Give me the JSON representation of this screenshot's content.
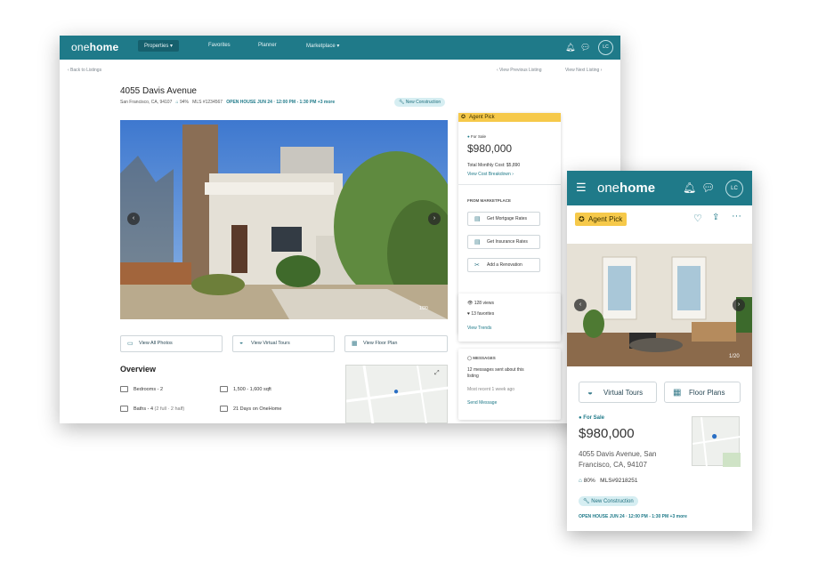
{
  "desktop": {
    "nav": {
      "logo_pre": "one",
      "logo_post": "home",
      "menu": [
        "Properties ▾",
        "Favorites",
        "Planner",
        "Marketplace ▾"
      ],
      "avatar": "LC"
    },
    "back_link": "‹ Back to Listings",
    "prev_link": "‹ View Previous Listing",
    "next_link": "View Next Listing ›",
    "listing": {
      "title": "4055 Davis Avenue",
      "address": "San Francisco, CA, 94107",
      "score": "94%",
      "mls": "MLS #1234567",
      "open_house": "OPEN HOUSE JUN 24 · 12:00 PM - 1:30 PM +3 more",
      "tag": "New Construction",
      "photo_count": "1/20"
    },
    "photo_buttons": [
      "View All Photos",
      "View Virtual Tours",
      "View Floor Plan"
    ],
    "overview": {
      "heading": "Overview",
      "facts": [
        "Bedrooms - 2",
        "1,500 - 1,600 sqft",
        "Baths - 4",
        "(2 full · 2 half)",
        "21 Days on OneHome"
      ]
    },
    "side": {
      "agent_pick": "Agent Pick",
      "status": "For Sale",
      "price": "$980,000",
      "monthly": "Total Monthly Cost: $5,890",
      "cost_link": "View Cost Breakdown ›",
      "marketplace_heading": "FROM MARKETPLACE",
      "marketplace": [
        "Get Mortgage Rates",
        "Get Insurance Rates",
        "Add a Renovation"
      ],
      "views": "128 views",
      "favorites": "13 favorites",
      "trends_link": "View Trends",
      "messages_heading": "MESSAGES",
      "messages_text1": "12 messages sent about this",
      "messages_text2": "listing",
      "messages_recent": "Most recent 1 week ago",
      "send_link": "Send Message"
    }
  },
  "mobile": {
    "nav": {
      "logo_pre": "one",
      "logo_post": "home",
      "avatar": "LC"
    },
    "agent_pick": "Agent Pick",
    "photo_count": "1/20",
    "buttons": [
      "Virtual Tours",
      "Floor Plans"
    ],
    "status": "For Sale",
    "price": "$980,000",
    "address1": "4055 Davis Avenue, San",
    "address2": "Francisco, CA, 94107",
    "score": "80%",
    "mls": "MLS#9218251",
    "tag": "New Construction",
    "open_house": "OPEN HOUSE JUN 24 · 12:00 PM - 1:30 PM +3 more"
  },
  "colors": {
    "brand": "#1f7a89",
    "agent_pick": "#f6c94a"
  }
}
